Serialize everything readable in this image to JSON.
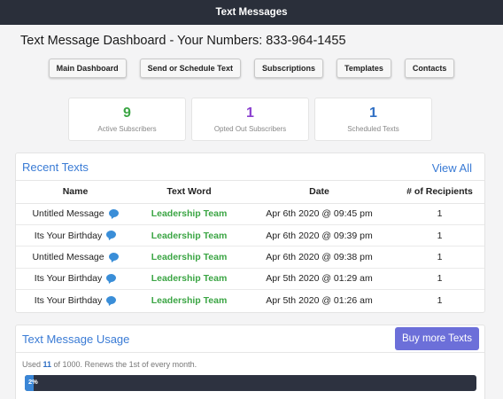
{
  "header": {
    "title": "Text Messages"
  },
  "dashboard": {
    "title": "Text Message Dashboard - Your Numbers: 833-964-1455"
  },
  "nav_buttons": [
    "Main Dashboard",
    "Send or Schedule Text",
    "Subscriptions",
    "Templates",
    "Contacts"
  ],
  "stats": [
    {
      "value": "9",
      "label": "Active Subscribers",
      "color": "#3ba544"
    },
    {
      "value": "1",
      "label": "Opted Out Subscribers",
      "color": "#8a3fcf"
    },
    {
      "value": "1",
      "label": "Scheduled Texts",
      "color": "#2f6fc4"
    }
  ],
  "recent": {
    "title": "Recent Texts",
    "view_all": "View All",
    "columns": [
      "Name",
      "Text Word",
      "Date",
      "# of Recipients"
    ],
    "rows": [
      {
        "name": "Untitled Message",
        "word": "Leadership Team",
        "date": "Apr 6th 2020 @ 09:45 pm",
        "recipients": "1"
      },
      {
        "name": "Its Your Birthday",
        "word": "Leadership Team",
        "date": "Apr 6th 2020 @ 09:39 pm",
        "recipients": "1"
      },
      {
        "name": "Untitled Message",
        "word": "Leadership Team",
        "date": "Apr 6th 2020 @ 09:38 pm",
        "recipients": "1"
      },
      {
        "name": "Its Your Birthday",
        "word": "Leadership Team",
        "date": "Apr 5th 2020 @ 01:29 am",
        "recipients": "1"
      },
      {
        "name": "Its Your Birthday",
        "word": "Leadership Team",
        "date": "Apr 5th 2020 @ 01:26 am",
        "recipients": "1"
      }
    ]
  },
  "usage": {
    "title": "Text Message Usage",
    "buy_label": "Buy more Texts",
    "used_prefix": "Used ",
    "used_count": "11",
    "used_suffix": " of 1000. Renews the 1st of every month.",
    "percent_label": "2%",
    "fraction": 0.02
  }
}
